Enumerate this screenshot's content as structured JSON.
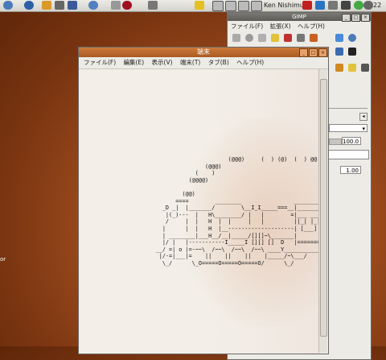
{
  "panel": {
    "user": "Ken Nishimura",
    "clock": "22"
  },
  "desktop": {
    "side_label": "or"
  },
  "gimp": {
    "title": "GIMP",
    "menu": [
      "ファイル(F)",
      "拡張(X)",
      "ヘルプ(H)"
    ],
    "opacity_value": "100.0",
    "size_value": "1.00"
  },
  "terminal": {
    "title": "端末",
    "menu": [
      "ファイル(F)",
      "編集(E)",
      "表示(V)",
      "端末(T)",
      "タブ(B)",
      "ヘルプ(H)"
    ],
    "ascii_art": "                                        (@@@)     (  ) (@)  (  ) @@    ()    @\n                                 (@@@)\n                              (    )\n                            (@@@@)\n\n                          (@@)\n                        ====        ________                ___________\n                    _D _|  |_______/        \\__I_I_____===__|_________|\n                     |(_)---  |   H\\________/ |   |        =|___ ___|     \n                     /     |  |   H  |  |     |   |         ||_| |_||     _\n                    |      |  |   H  |__--------------------| [___] |   =|\n                    | ________|___H__/__|_____/[][]~\\_______|       |   -|\n                    |/ |   |-----------I_____I [][] []  D   |=======|____|\n                  __/ =| o |=-~~\\  /~~\\  /~~\\  /~~\\ ____Y___________|__|___\n                   |/-=|___|=    ||    ||    ||    |_____/~\\___/          |_D__D__D_|  |_D__D__D_|\n                    \\_/      \\_O=====O=====O=====O/      \\_/               \\_/   \\_/    \\_/   \\_/"
  }
}
